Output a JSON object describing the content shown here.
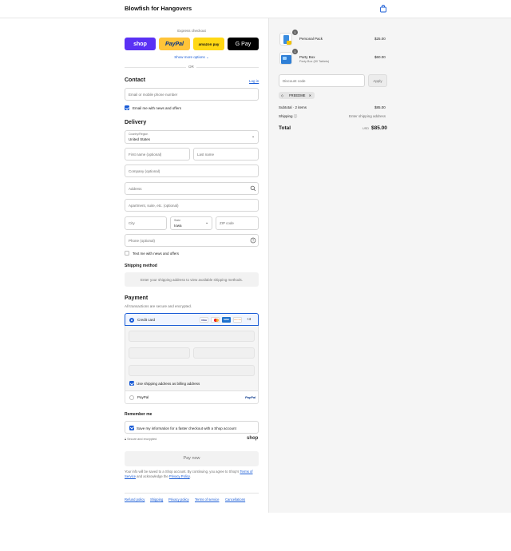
{
  "header": {
    "brand": "Blowfish for Hangovers"
  },
  "express": {
    "title": "Express checkout",
    "buttons": [
      "shop",
      "PayPal",
      "amazon pay",
      "G Pay"
    ],
    "more": "Show more options",
    "or": "OR"
  },
  "contact": {
    "title": "Contact",
    "login": "Log in",
    "email_placeholder": "Email or mobile phone number",
    "news_label": "Email me with news and offers"
  },
  "delivery": {
    "title": "Delivery",
    "country_label": "Country/Region",
    "country_value": "United States",
    "first_name": "First name (optional)",
    "last_name": "Last name",
    "company": "Company (optional)",
    "address": "Address",
    "apartment": "Apartment, suite, etc. (optional)",
    "city": "City",
    "state_label": "State",
    "state_value": "Iowa",
    "zip": "ZIP code",
    "phone": "Phone (optional)",
    "sms_label": "Text me with news and offers"
  },
  "shipping": {
    "title": "Shipping method",
    "note": "Enter your shipping address to view available shipping methods."
  },
  "payment": {
    "title": "Payment",
    "subtitle": "All transactions are secure and encrypted.",
    "credit_card": "Credit card",
    "card_brands": [
      "VISA",
      "MC",
      "AMEX",
      "DISCOVER"
    ],
    "more_cards": "+4",
    "billing_same": "Use shipping address as billing address",
    "paypal": "PayPal",
    "paypal_logo": "PayPal"
  },
  "remember": {
    "title": "Remember me",
    "save_label": "Save my information for a faster checkout with a Shop account",
    "secure": "Secure and encrypted",
    "shop_logo": "shop"
  },
  "pay_now": "Pay now",
  "disclaimer": {
    "text1": "Your info will be saved to a Shop account. By continuing, you agree to Shop's",
    "terms": "Terms of Service",
    "and": "and acknowledge the",
    "privacy": "Privacy Policy"
  },
  "footer": [
    "Refund policy",
    "Shipping",
    "Privacy policy",
    "Terms of service",
    "Cancellations"
  ],
  "summary": {
    "items": [
      {
        "name": "Personal Pack",
        "variant": "",
        "qty": "1",
        "price": "$25.00"
      },
      {
        "name": "Party Box",
        "variant": "Party Box (50 Tablets)",
        "qty": "1",
        "price": "$60.00"
      }
    ],
    "discount_placeholder": "Discount code",
    "apply": "Apply",
    "code": "FREEDME",
    "subtotal_label": "Subtotal · 2 items",
    "subtotal_value": "$85.00",
    "shipping_label": "Shipping",
    "shipping_value": "Enter shipping address",
    "total_label": "Total",
    "currency": "USD",
    "total_value": "$85.00"
  }
}
